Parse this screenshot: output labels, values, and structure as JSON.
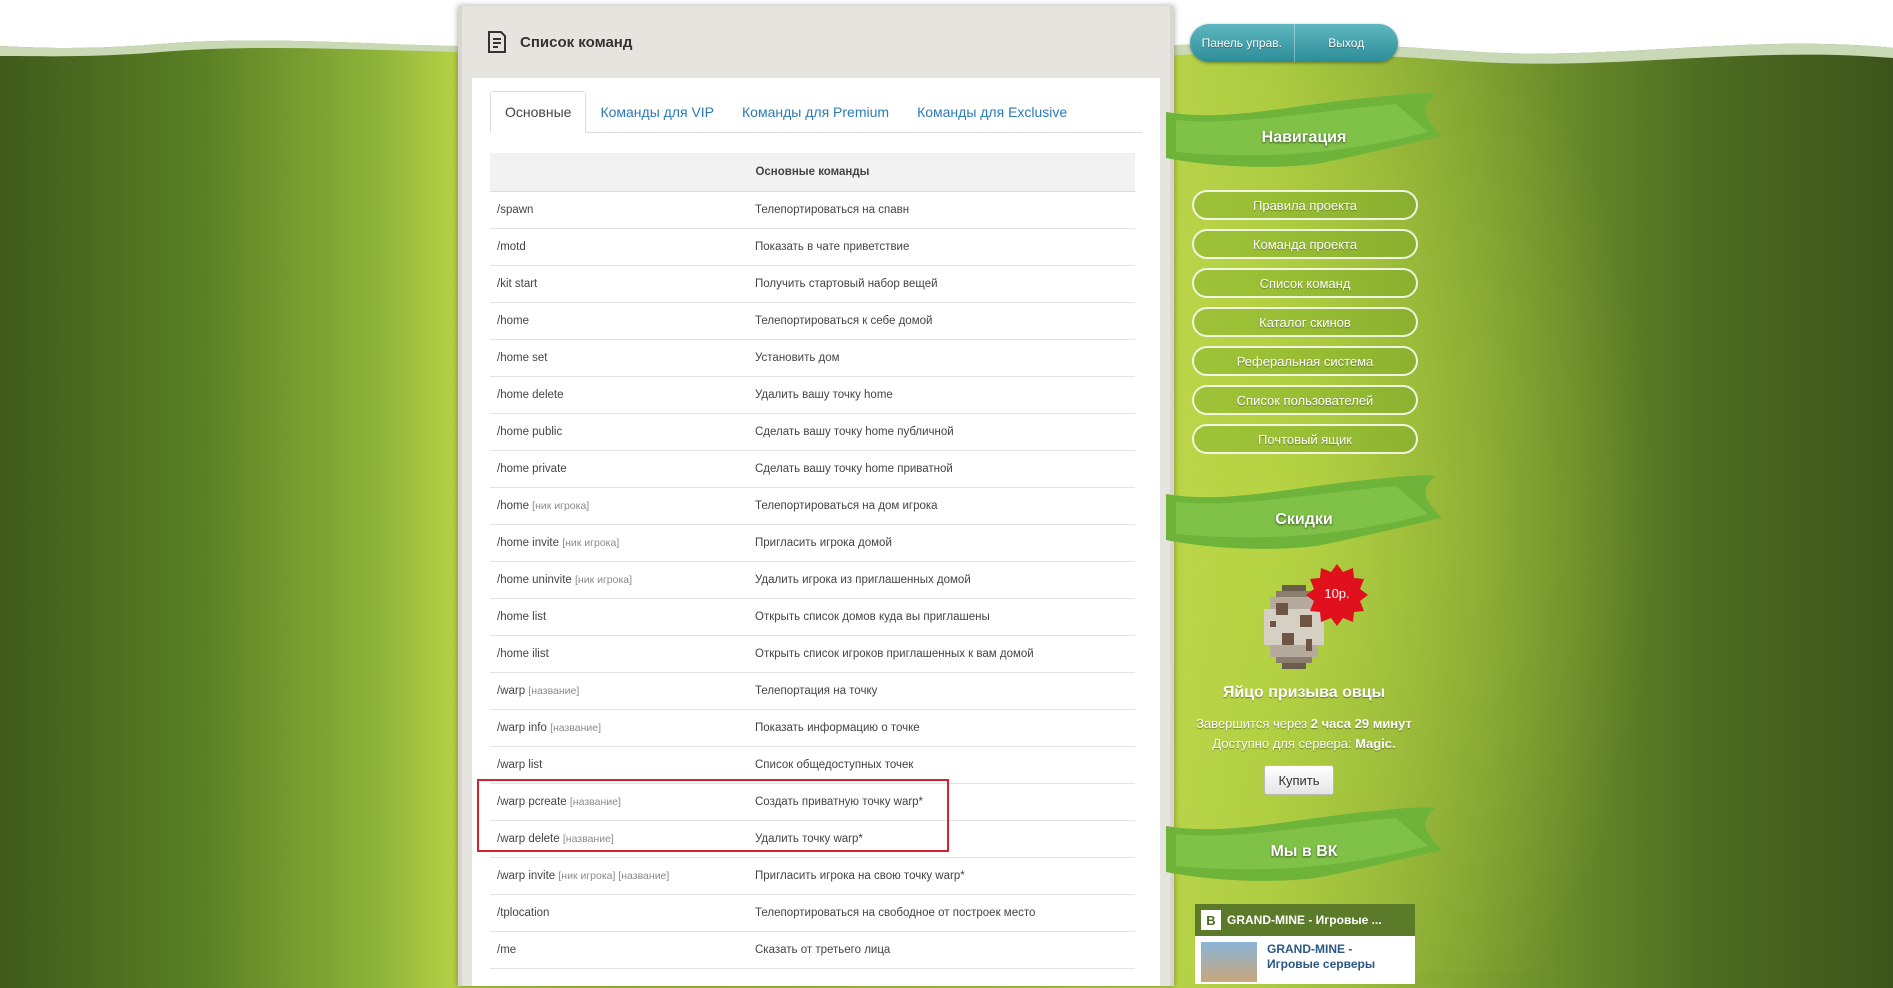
{
  "page": {
    "title": "Список команд"
  },
  "tabs": [
    {
      "label": "Основные"
    },
    {
      "label": "Команды для VIP"
    },
    {
      "label": "Команды для Premium"
    },
    {
      "label": "Команды для Exclusive"
    }
  ],
  "table": {
    "header": "Основные команды",
    "rows": [
      {
        "cmd": "/spawn",
        "arg": "",
        "desc": "Телепортироваться на спавн"
      },
      {
        "cmd": "/motd",
        "arg": "",
        "desc": "Показать в чате приветствие"
      },
      {
        "cmd": "/kit start",
        "arg": "",
        "desc": "Получить стартовый набор вещей"
      },
      {
        "cmd": "/home",
        "arg": "",
        "desc": "Телепортироваться к себе домой"
      },
      {
        "cmd": "/home set",
        "arg": "",
        "desc": "Установить дом"
      },
      {
        "cmd": "/home delete",
        "arg": "",
        "desc": "Удалить вашу точку home"
      },
      {
        "cmd": "/home public",
        "arg": "",
        "desc": "Сделать вашу точку home публичной"
      },
      {
        "cmd": "/home private",
        "arg": "",
        "desc": "Сделать вашу точку home приватной"
      },
      {
        "cmd": "/home",
        "arg": "[ник игрока]",
        "desc": "Телепортироваться на дом игрока"
      },
      {
        "cmd": "/home invite",
        "arg": "[ник игрока]",
        "desc": "Пригласить игрока домой"
      },
      {
        "cmd": "/home uninvite",
        "arg": "[ник игрока]",
        "desc": "Удалить игрока из приглашенных домой"
      },
      {
        "cmd": "/home list",
        "arg": "",
        "desc": "Открыть список домов куда вы приглашены"
      },
      {
        "cmd": "/home ilist",
        "arg": "",
        "desc": "Открыть список игроков приглашенных к вам домой"
      },
      {
        "cmd": "/warp",
        "arg": "[название]",
        "desc": "Телепортация на точку"
      },
      {
        "cmd": "/warp info",
        "arg": "[название]",
        "desc": "Показать информацию о точке"
      },
      {
        "cmd": "/warp list",
        "arg": "",
        "desc": "Список общедоступных точек"
      },
      {
        "cmd": "/warp pcreate",
        "arg": "[название]",
        "desc": "Создать приватную точку warp*"
      },
      {
        "cmd": "/warp delete",
        "arg": "[название]",
        "desc": "Удалить точку warp*"
      },
      {
        "cmd": "/warp invite",
        "arg": "[ник игрока] [название]",
        "desc": "Пригласить игрока на свою точку warp*"
      },
      {
        "cmd": "/tplocation",
        "arg": "",
        "desc": "Телепортироваться на свободное от построек место"
      },
      {
        "cmd": "/me",
        "arg": "",
        "desc": "Сказать от третьего лица"
      }
    ]
  },
  "top_buttons": {
    "panel": "Панель управ.",
    "logout": "Выход"
  },
  "sidebar": {
    "nav_title": "Навигация",
    "nav_items": [
      "Правила проекта",
      "Команда проекта",
      "Список команд",
      "Каталог скинов",
      "Реферальная система",
      "Список пользователей",
      "Почтовый ящик"
    ],
    "sale_title": "Скидки",
    "sale_price": "10р.",
    "sale_item": "Яйцо призыва овцы",
    "sale_ends_prefix": "Завершится через",
    "sale_ends_value": "2 часа 29 минут",
    "sale_server_prefix": "Доступно для сервера:",
    "sale_server_value": "Magic.",
    "buy_label": "Купить",
    "vk_title": "Мы в ВК",
    "vk_group": "GRAND-MINE - Игровые ...",
    "vk_name_line1": "GRAND-MINE -",
    "vk_name_line2": "Игровые серверы"
  },
  "colors": {
    "accent_link": "#2a7ab8",
    "highlight_border": "#d3232e",
    "sale_badge": "#e0101c"
  }
}
